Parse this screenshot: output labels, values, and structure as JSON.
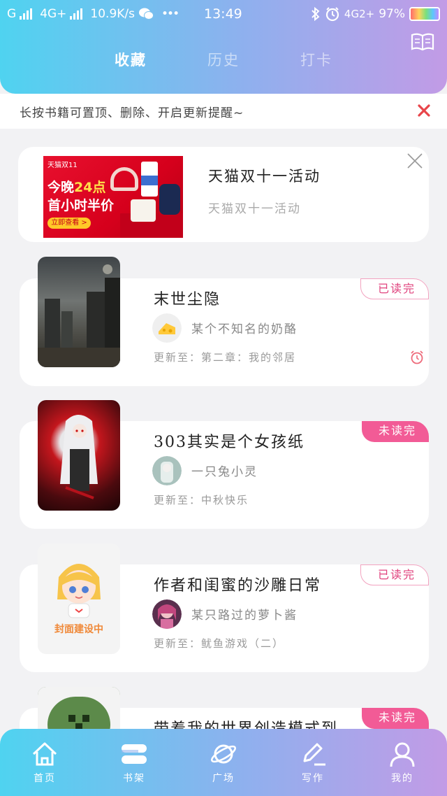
{
  "statusbar": {
    "carrier": "G",
    "network1": "4G+",
    "speed": "10.9K/s",
    "more": "•••",
    "time": "13:49",
    "network2": "4G2+",
    "battery": "97%"
  },
  "header": {
    "tabs": [
      {
        "label": "收藏",
        "active": true
      },
      {
        "label": "历史",
        "active": false
      },
      {
        "label": "打卡",
        "active": false
      }
    ],
    "right_icon": "book-icon"
  },
  "notice": {
    "text": "长按书籍可置顶、删除、开启更新提醒~",
    "close_icon": "close-icon"
  },
  "ad": {
    "title": "天猫双十一活动",
    "subtitle": "天猫双十一活动",
    "image": {
      "tag": "天猫双11",
      "line1_prefix": "今晚",
      "line1_highlight": "24点",
      "line2": "首小时半价",
      "button": "立即查看 >"
    }
  },
  "books": [
    {
      "title": "末世尘隐",
      "author": "某个不知名的奶酪",
      "update": "更新至：第二章：我的邻居",
      "badge": "已读完",
      "badge_type": "read",
      "alarm": true
    },
    {
      "title": "303其实是个女孩纸",
      "author": "一只兔小灵",
      "update": "更新至：中秋快乐",
      "badge": "未读完",
      "badge_type": "unread",
      "alarm": false
    },
    {
      "title": "作者和闺蜜的沙雕日常",
      "author": "某只路过的萝卜酱",
      "update": "更新至：鱿鱼游戏（二）",
      "badge": "已读完",
      "badge_type": "read",
      "alarm": false,
      "cover_text": "封面建设中"
    },
    {
      "title": "带着我的世界创造模式到",
      "badge": "未读完",
      "badge_type": "unread"
    }
  ],
  "tabbar": [
    {
      "label": "首页",
      "icon": "home-icon"
    },
    {
      "label": "书架",
      "icon": "bookshelf-icon"
    },
    {
      "label": "广场",
      "icon": "planet-icon"
    },
    {
      "label": "写作",
      "icon": "pencil-icon"
    },
    {
      "label": "我的",
      "icon": "user-icon"
    }
  ],
  "colors": {
    "gradient_start": "#4fd3f0",
    "gradient_end": "#c29be6",
    "badge_pink": "#f25b96",
    "close_red": "#e8454a"
  }
}
